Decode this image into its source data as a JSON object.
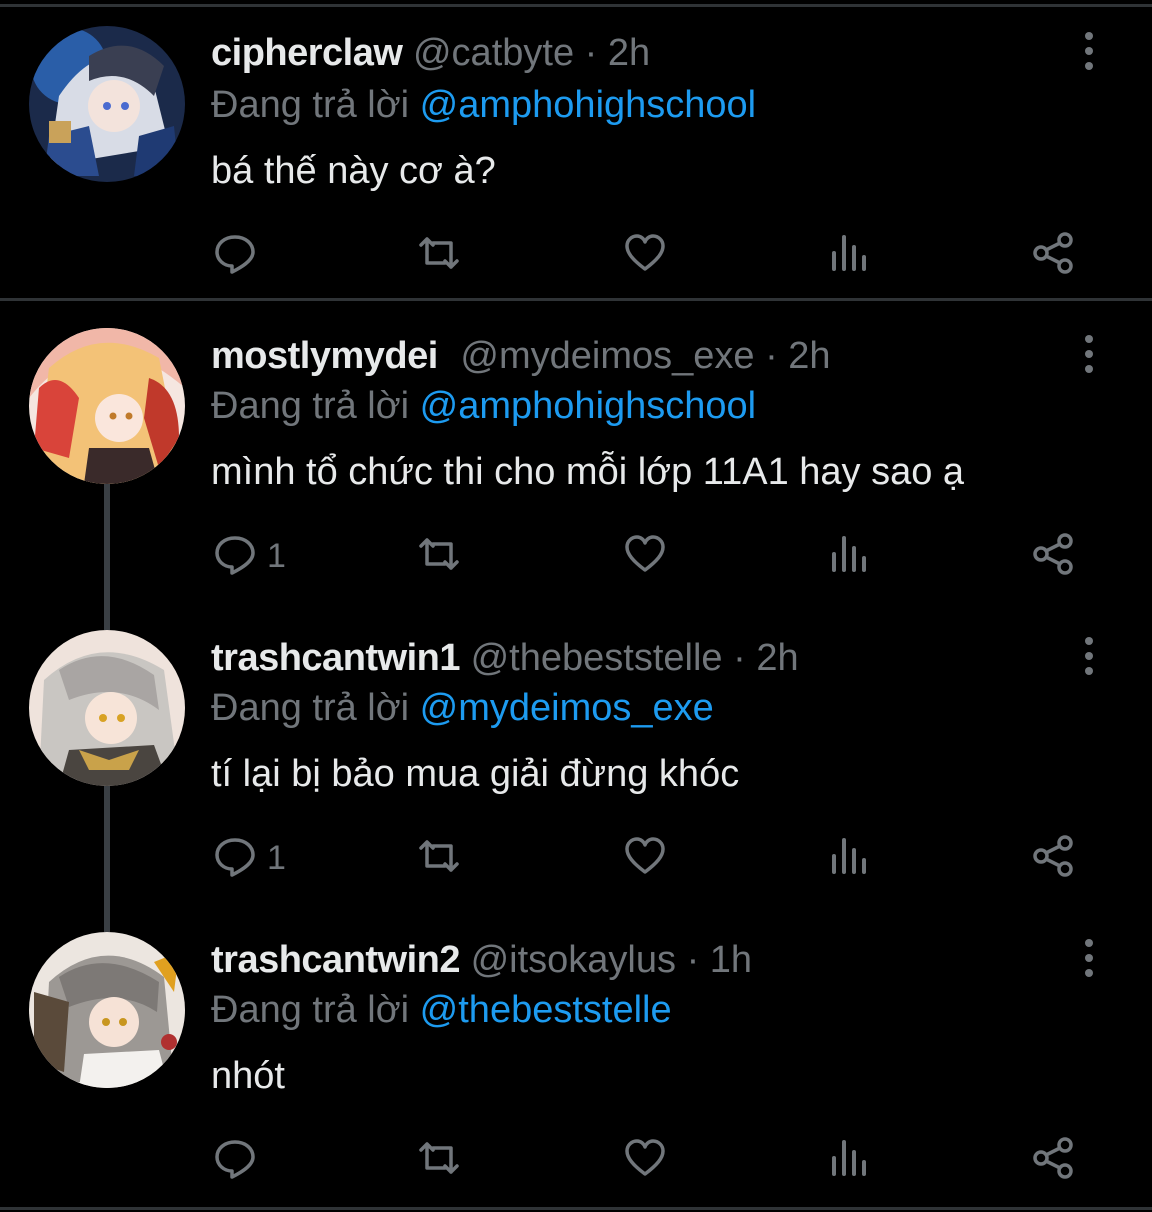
{
  "tweets": [
    {
      "username": "cipherclaw",
      "handle": "@catbyte",
      "separator": "·",
      "time": "2h",
      "replying_prefix": "Đang trả lời",
      "replying_to": "@amphohighschool",
      "text": "bá thế này cơ à?",
      "reply_count": ""
    },
    {
      "username": "mostlymydei",
      "handle": "@mydeimos_exe",
      "separator": "·",
      "time": "2h",
      "replying_prefix": "Đang trả lời",
      "replying_to": "@amphohighschool",
      "text": "mình tổ chức thi cho mỗi lớp 11A1 hay sao ạ",
      "reply_count": "1"
    },
    {
      "username": "trashcantwin1",
      "handle": "@thebeststelle",
      "separator": "·",
      "time": "2h",
      "replying_prefix": "Đang trả lời",
      "replying_to": "@mydeimos_exe",
      "text": "tí lại bị bảo mua giải đừng khóc",
      "reply_count": "1"
    },
    {
      "username": "trashcantwin2",
      "handle": "@itsokaylus",
      "separator": "·",
      "time": "1h",
      "replying_prefix": "Đang trả lời",
      "replying_to": "@thebeststelle",
      "text": "nhót",
      "reply_count": ""
    }
  ],
  "colors": {
    "background": "#000000",
    "text": "#e7e9ea",
    "muted": "#71767b",
    "mention": "#1d9bf0",
    "divider": "#2f3336"
  },
  "icons": [
    "reply-icon",
    "retweet-icon",
    "like-icon",
    "views-icon",
    "share-icon",
    "more-options-icon"
  ]
}
